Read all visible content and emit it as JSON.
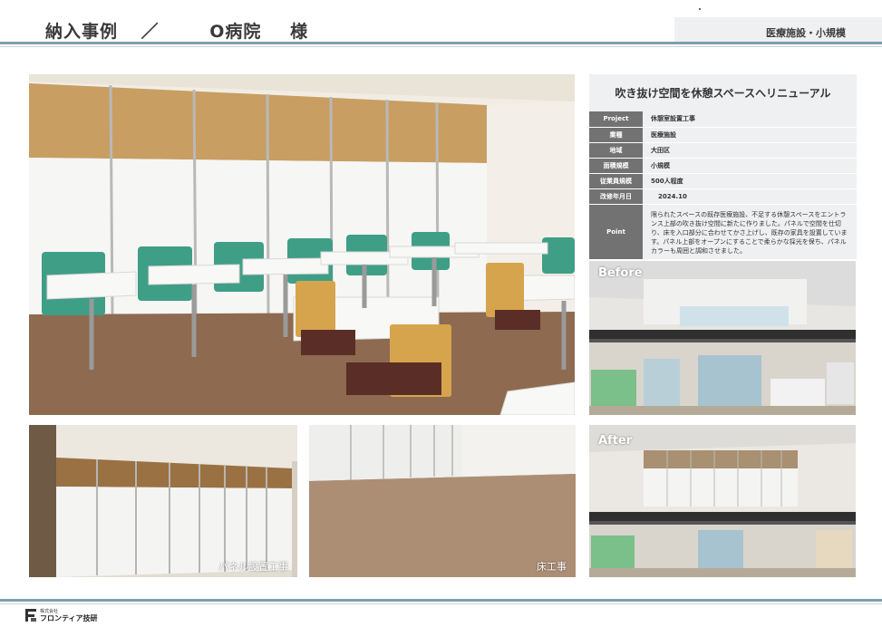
{
  "header": {
    "title_prefix": "納入事例",
    "slash": "／",
    "client": "O病院",
    "honorific": "様",
    "category_badge": "医療施設・小規模"
  },
  "info": {
    "title": "吹き抜け空間を休憩スペースへリニューアル",
    "rows": [
      {
        "key": "Project",
        "value": "休憩室設置工事"
      },
      {
        "key": "業種",
        "value": "医療施設"
      },
      {
        "key": "地域",
        "value": "大田区"
      },
      {
        "key": "面積規模",
        "value": "小規模"
      },
      {
        "key": "従業員規模",
        "value": "500人程度"
      },
      {
        "key": "改修年月日",
        "value": "2024.10"
      }
    ],
    "point_key": "Point",
    "point_value": "限られたスペースの既存医療施設、不足する休憩スペースをエントランス上部の吹き抜け空間に新たに作りました。パネルで空間を仕切り、床を入口部分に合わせてかさ上げし、既存の家具を設置しています。パネル上部をオープンにすることで柔らかな採光を保ち、パネルカラーも周囲と調和させました。"
  },
  "photos": {
    "before_label": "Before",
    "after_label": "After",
    "panel_caption": "パネル設置工事",
    "floor_caption": "床工事"
  },
  "footer": {
    "company_small": "株式会社",
    "company_name": "フロンティア技研"
  },
  "colors": {
    "accent_line": "#7f9fab",
    "badge_bg": "#eef0f2",
    "key_cell_bg": "#727272"
  }
}
